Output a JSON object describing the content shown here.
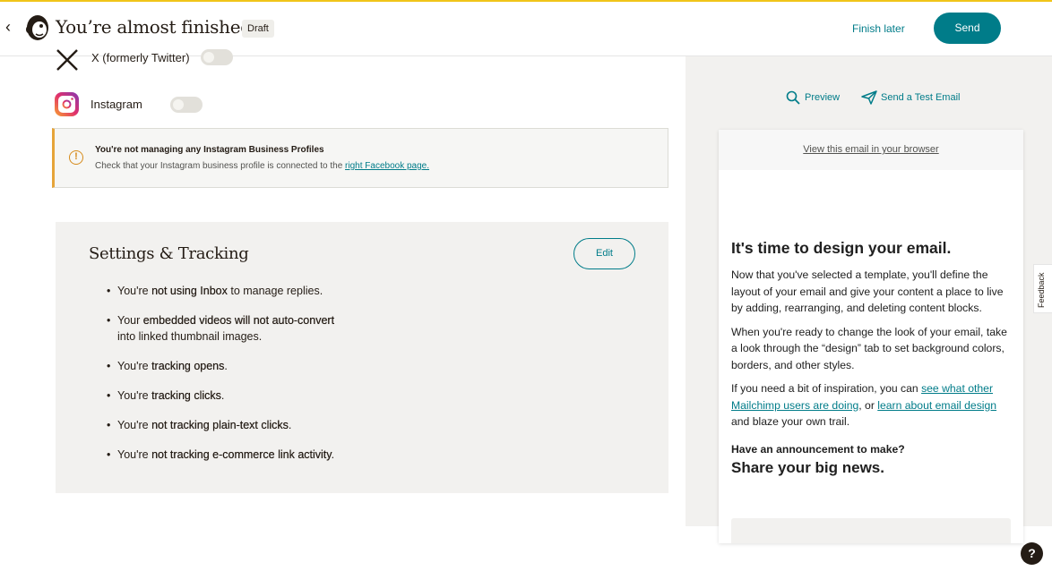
{
  "header": {
    "title": "You’re almost finished!",
    "badge": "Draft",
    "finish_later": "Finish later",
    "send": "Send"
  },
  "social": {
    "twitter_label": "X (formerly Twitter)",
    "instagram_label": "Instagram"
  },
  "warning": {
    "title": "You're not managing any Instagram Business Profiles",
    "text": "Check that your Instagram business profile is connected to the ",
    "link": "right Facebook page."
  },
  "settings": {
    "title": "Settings & Tracking",
    "edit": "Edit",
    "items": [
      {
        "pre": "You're ",
        "bold": "not using Inbox",
        "post": " to manage replies."
      },
      {
        "pre": "Your ",
        "bold": "embedded videos will not auto-convert",
        "post": "",
        "line2": "into linked thumbnail images."
      },
      {
        "pre": "You're ",
        "bold": "tracking opens",
        "post": "."
      },
      {
        "pre": "You're ",
        "bold": "tracking clicks",
        "post": "."
      },
      {
        "pre": "You're ",
        "bold": "not tracking plain-text clicks",
        "post": "."
      },
      {
        "pre": "You're ",
        "bold": "not tracking e-commerce link activity",
        "post": "."
      }
    ]
  },
  "preview": {
    "preview_label": "Preview",
    "test_label": "Send a Test Email"
  },
  "email": {
    "browser_link": "View this email in your browser",
    "heading": "It's time to design your email.",
    "p1": "Now that you've selected a template, you'll define the layout of your email and give your content a place to live by adding, rearranging, and deleting content blocks.",
    "p2": "When you're ready to change the look of your email, take a look through the “design” tab to set background colors, borders, and other styles.",
    "p3_pre": "If you need a bit of inspiration, you can ",
    "p3_link1": "see what other Mailchimp users are doing",
    "p3_mid": ", or ",
    "p3_link2": "learn about email design",
    "p3_post": " and blaze your own trail.",
    "announcement": "Have an announcement to make?",
    "big_news": "Share your big news."
  },
  "feedback": "Feedback",
  "help": "?",
  "colors": {
    "accent": "#007c89",
    "warning": "#e6a43a",
    "topline": "#f0c419"
  }
}
